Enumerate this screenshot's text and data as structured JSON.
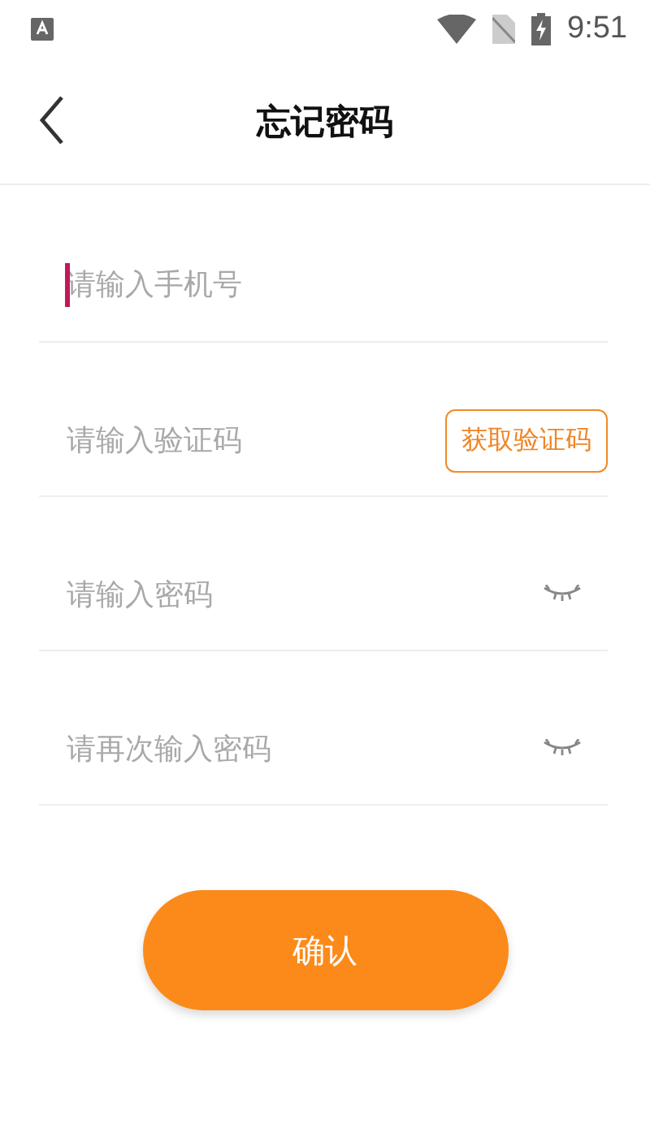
{
  "status_bar": {
    "time": "9:51"
  },
  "header": {
    "title": "忘记密码"
  },
  "fields": [
    {
      "kind": "plain",
      "placeholder": "请输入手机号",
      "focused": true
    },
    {
      "kind": "code",
      "placeholder": "请输入验证码",
      "focused": false,
      "button": "获取验证码"
    },
    {
      "kind": "password",
      "placeholder": "请输入密码",
      "focused": false,
      "visible": false
    },
    {
      "kind": "password",
      "placeholder": "请再次输入密码",
      "focused": false,
      "visible": false
    }
  ],
  "submit": "确认"
}
